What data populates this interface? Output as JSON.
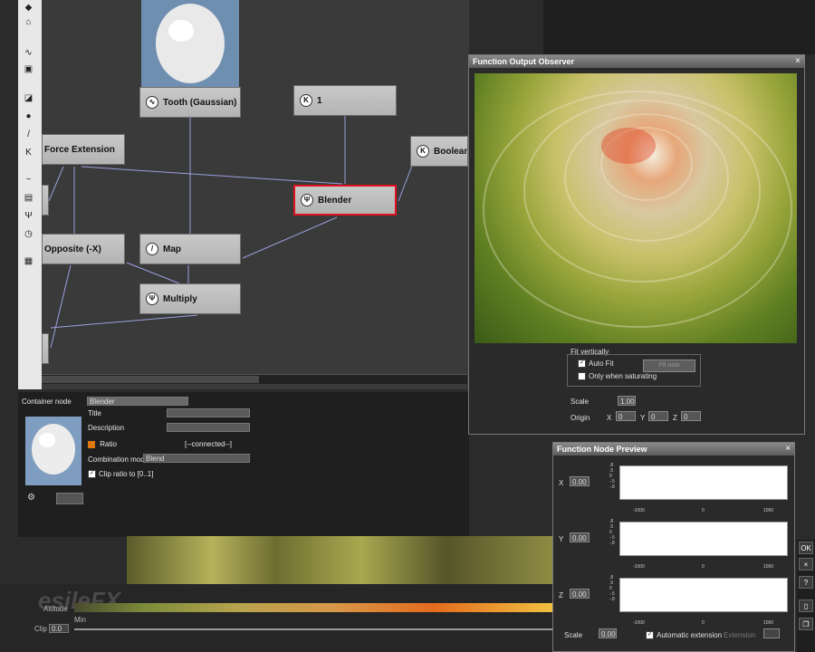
{
  "graph": {
    "nodes": {
      "tooth": {
        "label": "Tooth (Gaussian)",
        "icon": "wave-icon"
      },
      "k1": {
        "label": "1",
        "icon": "K"
      },
      "force": {
        "label": "Force Extension"
      },
      "boolean": {
        "label": "Boolean N",
        "icon": "K"
      },
      "blender": {
        "label": "Blender",
        "icon": "Ψ"
      },
      "opposite": {
        "label": "Opposite (-X)"
      },
      "map": {
        "label": "Map",
        "icon": "/"
      },
      "multiply": {
        "label": "Multiply",
        "icon": "Ψ"
      }
    }
  },
  "props": {
    "container_label": "Container node",
    "container_value": "Blender",
    "title_label": "Title",
    "title_value": "",
    "description_label": "Description",
    "description_value": "",
    "ratio_label": "Ratio",
    "ratio_value": "[--connected--]",
    "combination_label": "Combination mode",
    "combination_value": "Blend",
    "clip_label": "Clip ratio to [0..1]"
  },
  "footer": {
    "altitude_label": "Altitude",
    "min_label": "Min",
    "clip_label": "Clip",
    "clip_value": "0.0",
    "watermark": "esileFX"
  },
  "observer": {
    "title": "Function Output Observer",
    "close": "×",
    "fit_group": "Fit vertically",
    "auto_fit": "Auto Fit",
    "only_saturating": "Only when saturating",
    "fit_button": "Fit now",
    "scale_label": "Scale",
    "scale_value": "1.00",
    "origin_label": "Origin",
    "x_label": "X",
    "x_value": "0",
    "y_label": "Y",
    "y_value": "0",
    "z_label": "Z",
    "z_value": "0"
  },
  "preview": {
    "title": "Function Node Preview",
    "close": "×",
    "rows": [
      {
        "axis": "X",
        "value": "0.00"
      },
      {
        "axis": "Y",
        "value": "0.00"
      },
      {
        "axis": "Z",
        "value": "0.00"
      }
    ],
    "ticks": [
      ".8",
      ".5",
      "0",
      "-.5",
      "-.8"
    ],
    "axis_min": "-1000",
    "axis_mid": "0",
    "axis_max": "1000",
    "scale_label": "Scale",
    "scale_value": "0.00",
    "auto_ext": "Automatic extension",
    "extension_label": "Extension"
  },
  "side": {
    "ok": "OK",
    "cancel": "×",
    "help": "?"
  },
  "colors": {
    "selected_border": "#e01020",
    "panel_bg": "#2b2b2b",
    "node_bg": "#c0c0c0"
  }
}
